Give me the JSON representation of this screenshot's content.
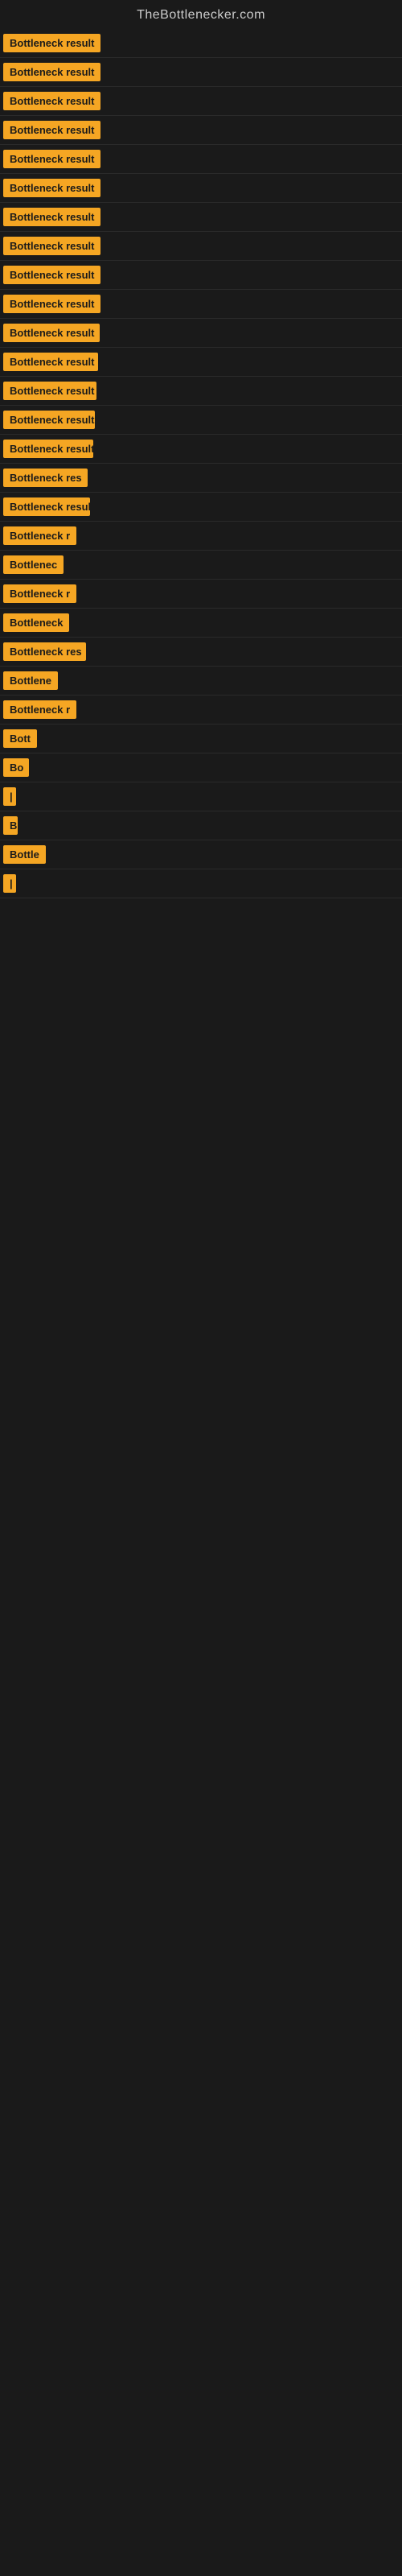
{
  "header": {
    "title": "TheBottlenecker.com"
  },
  "items": [
    {
      "label": "Bottleneck result",
      "width": 140
    },
    {
      "label": "Bottleneck result",
      "width": 140
    },
    {
      "label": "Bottleneck result",
      "width": 135
    },
    {
      "label": "Bottleneck result",
      "width": 133
    },
    {
      "label": "Bottleneck result",
      "width": 133
    },
    {
      "label": "Bottleneck result",
      "width": 130
    },
    {
      "label": "Bottleneck result",
      "width": 128
    },
    {
      "label": "Bottleneck result",
      "width": 126
    },
    {
      "label": "Bottleneck result",
      "width": 124
    },
    {
      "label": "Bottleneck result",
      "width": 122
    },
    {
      "label": "Bottleneck result",
      "width": 120
    },
    {
      "label": "Bottleneck result",
      "width": 118
    },
    {
      "label": "Bottleneck result",
      "width": 116
    },
    {
      "label": "Bottleneck result",
      "width": 114
    },
    {
      "label": "Bottleneck result",
      "width": 112
    },
    {
      "label": "Bottleneck res",
      "width": 105
    },
    {
      "label": "Bottleneck result",
      "width": 108
    },
    {
      "label": "Bottleneck r",
      "width": 95
    },
    {
      "label": "Bottlenec",
      "width": 82
    },
    {
      "label": "Bottleneck r",
      "width": 95
    },
    {
      "label": "Bottleneck",
      "width": 88
    },
    {
      "label": "Bottleneck res",
      "width": 103
    },
    {
      "label": "Bottlene",
      "width": 76
    },
    {
      "label": "Bottleneck r",
      "width": 93
    },
    {
      "label": "Bott",
      "width": 48
    },
    {
      "label": "Bo",
      "width": 32
    },
    {
      "label": "|",
      "width": 10
    },
    {
      "label": "B",
      "width": 18
    },
    {
      "label": "Bottle",
      "width": 55
    },
    {
      "label": "|",
      "width": 8
    }
  ]
}
